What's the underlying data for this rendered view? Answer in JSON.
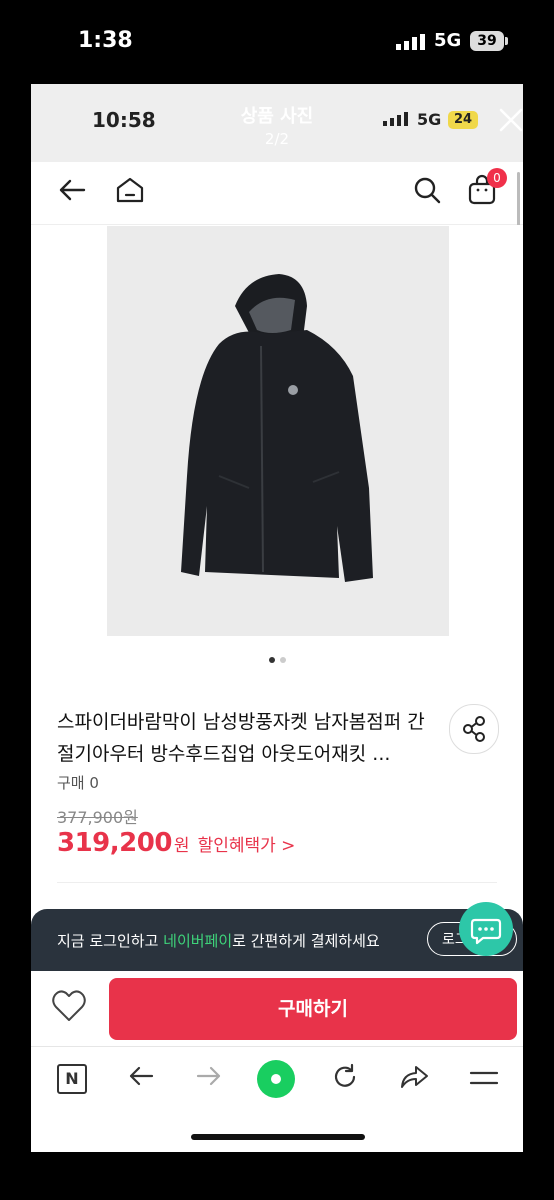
{
  "outer_status": {
    "time": "1:38",
    "network": "5G",
    "battery": "39"
  },
  "inner_status": {
    "time": "10:58",
    "network": "5G",
    "battery": "24"
  },
  "viewer": {
    "title": "상품 사진",
    "counter": "2/2"
  },
  "nav": {
    "cart_count": "0"
  },
  "product": {
    "title": "스파이더바람막이 남성방풍자켓 남자봄점퍼 간절기아우터 방수후드집업 아웃도어재킷 ...",
    "purchase_count": "구매 0",
    "original_price": "377,900원",
    "sale_price": "319,200",
    "sale_unit": "원",
    "discount_link": "할인혜택가 >"
  },
  "login_banner": {
    "text_before": "지금 로그인하고 ",
    "text_highlight": "네이버페이",
    "text_after": "로 간편하게 결제하세요",
    "button_label": "로그인"
  },
  "buy_button": "구매하기",
  "browser_bar": {
    "n_label": "N"
  },
  "colors": {
    "accent": "#e8334a",
    "naver_green": "#19ce60",
    "banner_bg": "#2a333d",
    "chat_fab": "#2dc7a8",
    "battery_inner": "#f0d84a"
  },
  "icons": [
    "back-arrow-icon",
    "home-icon",
    "search-icon",
    "cart-icon",
    "share-icon",
    "heart-icon",
    "chat-icon",
    "close-icon",
    "reload-icon",
    "forward-arrow-icon",
    "menu-icon"
  ]
}
